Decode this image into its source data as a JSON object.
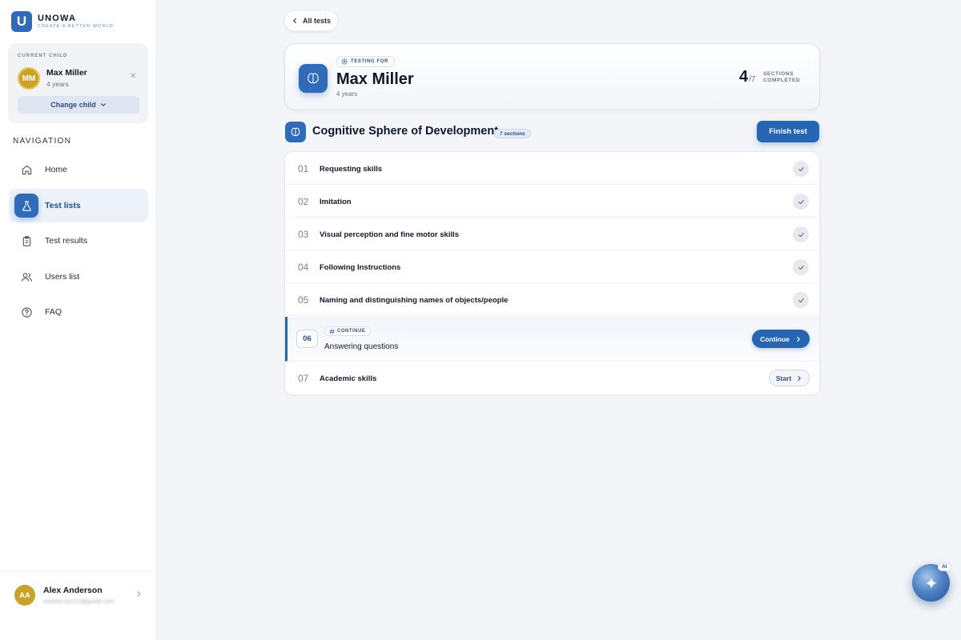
{
  "brand": {
    "logo_letter": "U",
    "name": "UNOWA",
    "tagline": "CREATE A BETTER WORLD",
    "color": "#2f6bb9"
  },
  "current_child": {
    "label": "CURRENT CHILD",
    "initials": "MM",
    "name": "Max Miller",
    "age": "4 years",
    "change_label": "Change child"
  },
  "navigation": {
    "heading": "NAVIGATION",
    "items": [
      {
        "label": "Home",
        "icon": "home-icon",
        "active": false
      },
      {
        "label": "Test lists",
        "icon": "flask-icon",
        "active": true
      },
      {
        "label": "Test results",
        "icon": "clipboard-icon",
        "active": false
      },
      {
        "label": "Users list",
        "icon": "users-icon",
        "active": false
      },
      {
        "label": "FAQ",
        "icon": "help-circle-icon",
        "active": false
      }
    ]
  },
  "user": {
    "initials": "AA",
    "name": "Alex Anderson",
    "email": "october.01127@gmail.com"
  },
  "back_label": "All tests",
  "hero": {
    "badge": "TESTING FOR",
    "name": "Max Miller",
    "age": "4 years",
    "completed": "4",
    "total": "/7",
    "completed_label_1": "SECTIONS",
    "completed_label_2": "COMPLETED"
  },
  "section": {
    "title": "Cognitive Sphere of Development",
    "count_label": "7 sections",
    "finish_label": "Finish test"
  },
  "rows": [
    {
      "num": "01",
      "title": "Requesting skills",
      "status": "done"
    },
    {
      "num": "02",
      "title": "Imitation",
      "status": "done"
    },
    {
      "num": "03",
      "title": "Visual perception and fine motor skills",
      "status": "done"
    },
    {
      "num": "04",
      "title": "Following Instructions",
      "status": "done"
    },
    {
      "num": "05",
      "title": "Naming and distinguishing names of objects/people",
      "status": "done"
    },
    {
      "num": "06",
      "title": "Answering questions",
      "status": "current",
      "badge": "CONTINUE",
      "action": "Continue"
    },
    {
      "num": "07",
      "title": "Academic skills",
      "status": "todo",
      "action": "Start"
    }
  ],
  "ai_label": "AI",
  "colors": {
    "accent": "#2565b2",
    "avatar": "#c9a227",
    "background": "#f4f5f8"
  }
}
